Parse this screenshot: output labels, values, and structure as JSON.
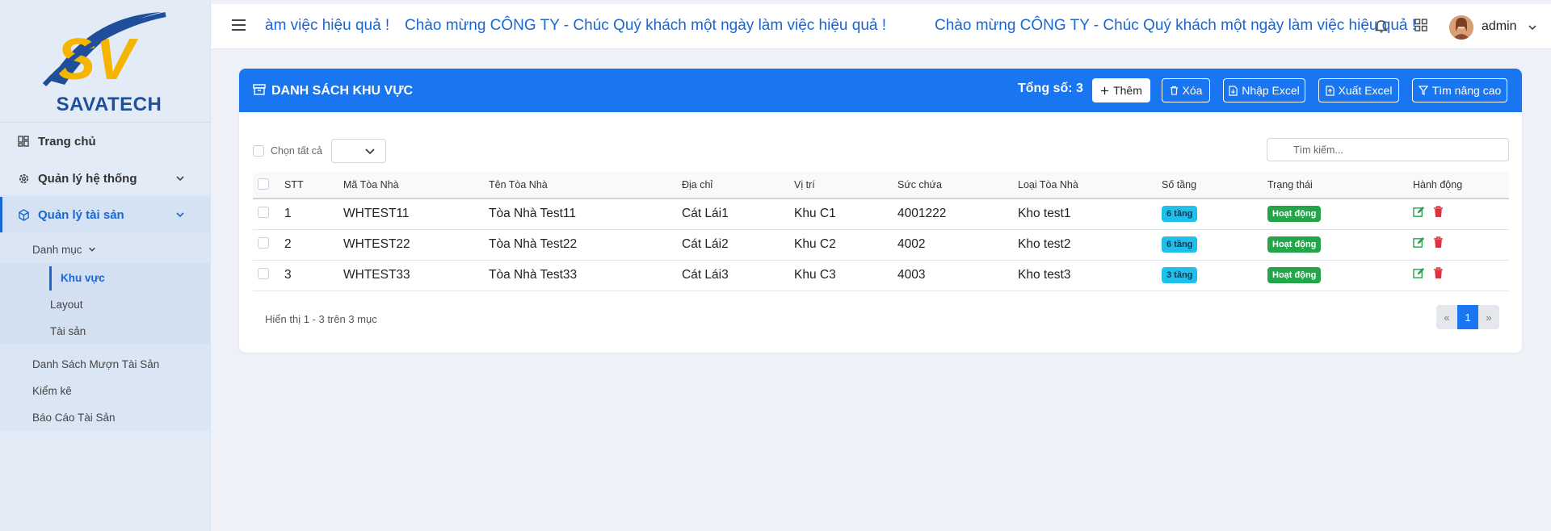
{
  "brand": {
    "logo_text": "SAVATECH",
    "accent": "#1976f0",
    "logo_colors": [
      "#f4b400",
      "#1f4f9a"
    ]
  },
  "sidebar": {
    "items": [
      {
        "label": "Trang chủ",
        "icon": "dashboard-icon"
      },
      {
        "label": "Quản lý hệ thống",
        "icon": "gear-icon"
      },
      {
        "label": "Quản lý tài sản",
        "icon": "cube-icon"
      }
    ],
    "group_label": "Danh mục",
    "group_items": [
      "Khu vực",
      "Layout",
      "Tài sản"
    ],
    "other_items": [
      "Danh Sách Mượn Tài Sản",
      "Kiểm kê",
      "Báo Cáo Tài Sản"
    ]
  },
  "topbar": {
    "marquee": [
      "àm việc hiệu quả !",
      "Chào mừng CÔNG TY - Chúc Quý khách một ngày làm việc hiệu quả !",
      "Chào mừng CÔNG TY - Chúc Quý khách một ngày làm việc hiệu quả !"
    ],
    "user": "admin"
  },
  "card": {
    "title": "DANH SÁCH KHU VỰC",
    "total": "Tổng số: 3",
    "buttons": {
      "add": "Thêm",
      "delete": "Xóa",
      "import": "Nhập Excel",
      "export": "Xuất Excel",
      "advanced": "Tìm nâng cao"
    },
    "select_all": "Chọn tất cả",
    "search_placeholder": "Tìm kiếm...",
    "columns": [
      "STT",
      "Mã Tòa Nhà",
      "Tên Tòa Nhà",
      "Địa chỉ",
      "Vị trí",
      "Sức chứa",
      "Loại Tòa Nhà",
      "Số tầng",
      "Trạng thái",
      "Hành động"
    ],
    "rows": [
      {
        "stt": "1",
        "code": "WHTEST11",
        "name": "Tòa Nhà Test11",
        "address": "Cát Lái1",
        "location": "Khu C1",
        "capacity": "4001222",
        "type": "Kho test1",
        "floors": "6 tầng",
        "status": "Hoạt động"
      },
      {
        "stt": "2",
        "code": "WHTEST22",
        "name": "Tòa Nhà Test22",
        "address": "Cát Lái2",
        "location": "Khu C2",
        "capacity": "4002",
        "type": "Kho test2",
        "floors": "6 tầng",
        "status": "Hoạt động"
      },
      {
        "stt": "3",
        "code": "WHTEST33",
        "name": "Tòa Nhà Test33",
        "address": "Cát Lái3",
        "location": "Khu C3",
        "capacity": "4003",
        "type": "Kho test3",
        "floors": "3 tầng",
        "status": "Hoạt động"
      }
    ],
    "summary": "Hiển thị 1 - 3 trên 3 mục",
    "pager": {
      "prev": "«",
      "current": "1",
      "next": "»"
    }
  }
}
